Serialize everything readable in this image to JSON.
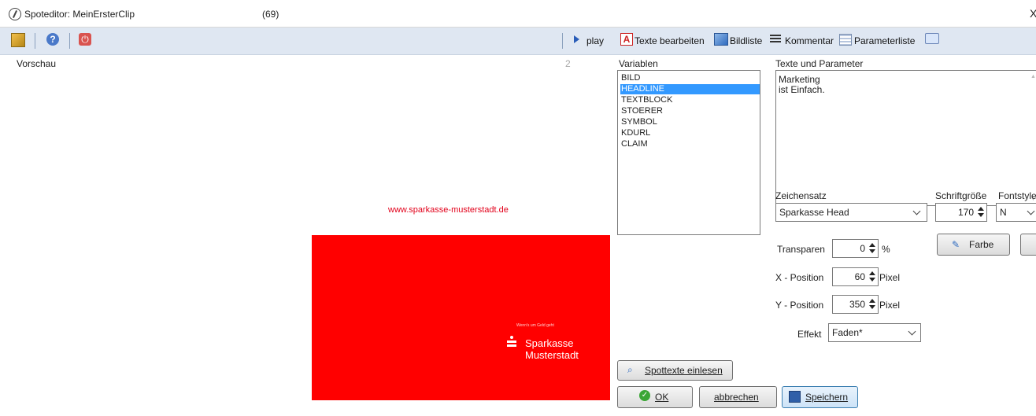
{
  "window": {
    "title": "Spoteditor: MeinErsterClip",
    "count": "(69)",
    "close": "X"
  },
  "toolbar": {
    "play": "play",
    "edit_texts": "Texte bearbeiten",
    "image_list": "Bildliste",
    "comment": "Kommentar",
    "param_list": "Parameterliste",
    "help_glyph": "?",
    "power_glyph": "⏻",
    "text_glyph": "A"
  },
  "preview": {
    "label": "Vorschau",
    "number": "2",
    "url": "www.sparkasse-musterstadt.de",
    "slogan": "Wenn's um Geld geht",
    "brand_line1": "Sparkasse",
    "brand_line2": "Musterstadt",
    "brand_color": "#ff0000"
  },
  "variables": {
    "label": "Variablen",
    "items": [
      "BILD",
      "HEADLINE",
      "TEXTBLOCK",
      "STOERER",
      "SYMBOL",
      "KDURL",
      "CLAIM"
    ],
    "selected": "HEADLINE"
  },
  "params": {
    "label": "Texte und Parameter",
    "text_line1": "Marketing",
    "text_line2": "ist Einfach.",
    "font_label": "Zeichensatz",
    "font_value": "Sparkasse Head",
    "size_label": "Schriftgröße",
    "size_value": "170",
    "style_label": "Fontstyle",
    "style_value": "N",
    "color_button": "Farbe",
    "transparency_label": "Transparen",
    "transparency_value": "0",
    "transparency_unit": "%",
    "x_label": "X - Position",
    "x_value": "60",
    "x_unit": "Pixel",
    "y_label": "Y - Position",
    "y_value": "350",
    "y_unit": "Pixel",
    "effect_label": "Effekt",
    "effect_value": "Faden*"
  },
  "buttons": {
    "read_texts": "Spottexte einlesen",
    "ok": "OK",
    "cancel": "abbrechen",
    "save": "Speichern"
  },
  "colors": {
    "accent": "#3399ff",
    "toolbar": "#dfe7f2",
    "url": "#e2001a"
  }
}
